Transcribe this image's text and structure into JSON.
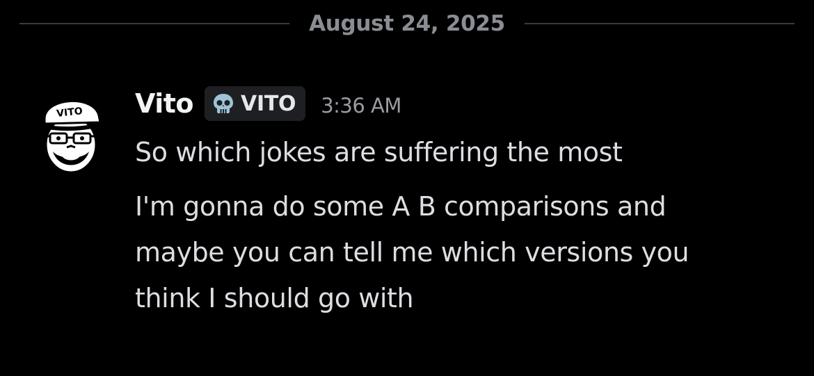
{
  "date_divider": {
    "label": "August 24, 2025"
  },
  "message": {
    "author": "Vito",
    "role_tag": {
      "icon": "skull-icon",
      "label": "VITO",
      "color": "#9cc4d6"
    },
    "timestamp": "3:36 AM",
    "avatar": {
      "cap_text": "VITO"
    },
    "lines": [
      "So which jokes are suffering the most",
      "I'm gonna do some A B comparisons and",
      "maybe you can tell me which versions you",
      "think I should go with"
    ]
  },
  "colors": {
    "background": "#000000",
    "divider_line": "#3a3b40",
    "muted_text": "#8b8d94",
    "body_text": "#dcdee2",
    "tag_background": "#1e1f22"
  }
}
